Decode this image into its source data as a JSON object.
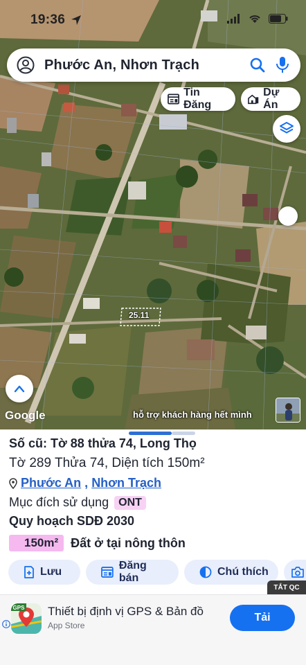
{
  "status_bar": {
    "time": "19:36"
  },
  "search": {
    "text": "Phước An, Nhơn Trạch"
  },
  "map_chips": {
    "tin_dang": "Tin Đăng",
    "du_an": "Dự Án"
  },
  "map": {
    "parcel_label": "25.11",
    "google_logo": "Google",
    "support_text": "hỗ trợ khách hàng hết mình"
  },
  "parcel": {
    "old_number": "Số cũ: Tờ 88 thửa 74, Long Thọ",
    "new_number": "Tờ 289 Thửa 74, Diện tích 150m²",
    "ward": "Phước An",
    "separator": ",",
    "district": "Nhơn Trạch",
    "purpose_label": "Mục đích sử dụng",
    "purpose_code": "ONT",
    "plan_title": "Quy hoạch SDĐ 2030",
    "plan_area": "150m²",
    "plan_desc": "Đất ở tại nông thôn"
  },
  "actions": {
    "save": "Lưu",
    "post": "Đăng bán",
    "legend": "Chú thích"
  },
  "ad": {
    "tag": "TẮT QC",
    "icon_text": "GPS",
    "title": "Thiết bị định vị GPS & Bản đồ",
    "subtitle": "App Store",
    "cta": "Tải"
  },
  "colors": {
    "accent": "#1671f0",
    "link": "#2560c6",
    "badge_pink": "#f5b9f0",
    "action_bg": "#e8eefb"
  }
}
